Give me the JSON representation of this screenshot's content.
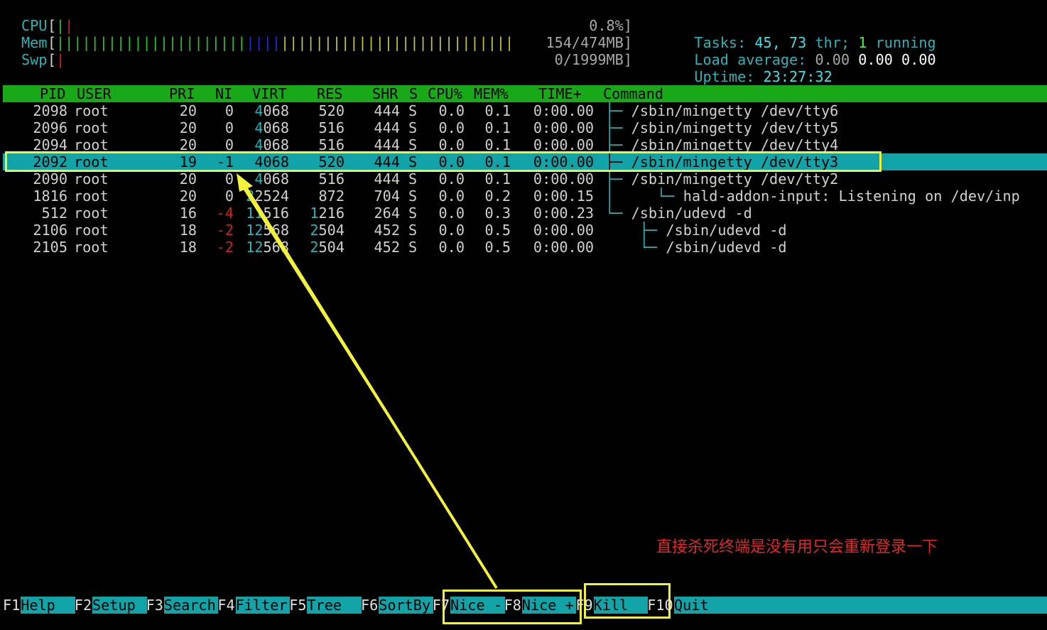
{
  "meters": {
    "cpu": {
      "label": "CPU",
      "value": "0.8%]"
    },
    "mem": {
      "label": "Mem",
      "value": "154/474MB]"
    },
    "swp": {
      "label": "Swp",
      "value": "0/1999MB]"
    }
  },
  "stats": {
    "tasks_label": "Tasks:",
    "tasks_count": "45,",
    "threads_count": "73",
    "thr_label": "thr;",
    "running_count": "1",
    "running_label": "running",
    "load_label": "Load average:",
    "load_1": "0.00",
    "load_5": "0.00",
    "load_15": "0.00",
    "uptime_label": "Uptime:",
    "uptime_value": "23:27:32"
  },
  "table": {
    "columns": [
      "PID",
      "USER",
      "PRI",
      "NI",
      "VIRT",
      "RES",
      "SHR",
      "S",
      "CPU%",
      "MEM%",
      "TIME+",
      "Command"
    ],
    "rows": [
      {
        "pid": "2098",
        "user": "root",
        "pri": "20",
        "ni": "0",
        "virt_hi": "4",
        "virt_lo": "068",
        "res_hi": "",
        "res_lo": "520",
        "shr": "444",
        "s": "S",
        "cpu": "0.0",
        "mem": "0.1",
        "time": "0:00.00",
        "tree": "├─ ",
        "cmd": "/sbin/mingetty /dev/tty6"
      },
      {
        "pid": "2096",
        "user": "root",
        "pri": "20",
        "ni": "0",
        "virt_hi": "4",
        "virt_lo": "068",
        "res_hi": "",
        "res_lo": "516",
        "shr": "444",
        "s": "S",
        "cpu": "0.0",
        "mem": "0.1",
        "time": "0:00.00",
        "tree": "├─ ",
        "cmd": "/sbin/mingetty /dev/tty5"
      },
      {
        "pid": "2094",
        "user": "root",
        "pri": "20",
        "ni": "0",
        "virt_hi": "4",
        "virt_lo": "068",
        "res_hi": "",
        "res_lo": "516",
        "shr": "444",
        "s": "S",
        "cpu": "0.0",
        "mem": "0.1",
        "time": "0:00.00",
        "tree": "├─ ",
        "cmd": "/sbin/mingetty /dev/tty4"
      },
      {
        "pid": "2092",
        "user": "root",
        "pri": "19",
        "ni": "-1",
        "virt_hi": "4",
        "virt_lo": "068",
        "res_hi": "",
        "res_lo": "520",
        "shr": "444",
        "s": "S",
        "cpu": "0.0",
        "mem": "0.1",
        "time": "0:00.00",
        "tree": "├─ ",
        "cmd": "/sbin/mingetty /dev/tty3",
        "selected": true
      },
      {
        "pid": "2090",
        "user": "root",
        "pri": "20",
        "ni": "0",
        "virt_hi": "4",
        "virt_lo": "068",
        "res_hi": "",
        "res_lo": "516",
        "shr": "444",
        "s": "S",
        "cpu": "0.0",
        "mem": "0.1",
        "time": "0:00.00",
        "tree": "├─ ",
        "cmd": "/sbin/mingetty /dev/tty2"
      },
      {
        "pid": "1816",
        "user": "root",
        "pri": "20",
        "ni": "0",
        "virt_hi": "2",
        "virt_lo": "2524",
        "res_hi": "",
        "res_lo": "872",
        "shr": "704",
        "s": "S",
        "cpu": "0.0",
        "mem": "0.2",
        "time": "0:00.15",
        "tree": "│     └─ ",
        "cmd": "hald-addon-input: Listening on /dev/inp"
      },
      {
        "pid": "512",
        "user": "root",
        "pri": "16",
        "ni": "-4",
        "virt_hi": "11",
        "virt_lo": "516",
        "res_hi": "1",
        "res_lo": "216",
        "shr": "264",
        "s": "S",
        "cpu": "0.0",
        "mem": "0.3",
        "time": "0:00.23",
        "tree": "└─ ",
        "cmd": "/sbin/udevd -d"
      },
      {
        "pid": "2106",
        "user": "root",
        "pri": "18",
        "ni": "-2",
        "virt_hi": "12",
        "virt_lo": "568",
        "res_hi": "2",
        "res_lo": "504",
        "shr": "452",
        "s": "S",
        "cpu": "0.0",
        "mem": "0.5",
        "time": "0:00.00",
        "tree": "    ├─ ",
        "cmd": "/sbin/udevd -d"
      },
      {
        "pid": "2105",
        "user": "root",
        "pri": "18",
        "ni": "-2",
        "virt_hi": "12",
        "virt_lo": "568",
        "res_hi": "2",
        "res_lo": "504",
        "shr": "452",
        "s": "S",
        "cpu": "0.0",
        "mem": "0.5",
        "time": "0:00.00",
        "tree": "    └─ ",
        "cmd": "/sbin/udevd -d"
      }
    ]
  },
  "annotation": "直接杀死终端是没有用只会重新登录一下",
  "function_keys": [
    {
      "key": "F1",
      "label": "Help  "
    },
    {
      "key": "F2",
      "label": "Setup "
    },
    {
      "key": "F3",
      "label": "Search"
    },
    {
      "key": "F4",
      "label": "Filter"
    },
    {
      "key": "F5",
      "label": "Tree  "
    },
    {
      "key": "F6",
      "label": "SortBy"
    },
    {
      "key": "F7",
      "label": "Nice -"
    },
    {
      "key": "F8",
      "label": "Nice +"
    },
    {
      "key": "F9",
      "label": "Kill  "
    },
    {
      "key": "F10",
      "label": "Quit  "
    }
  ],
  "colors": {
    "header_bg": "#18a818",
    "selection_bg": "#11a3a8",
    "highlight": "#f2f23a",
    "annotation": "#e02828"
  }
}
